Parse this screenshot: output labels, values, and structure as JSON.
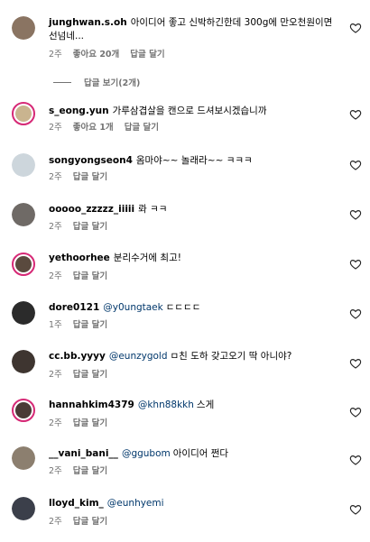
{
  "comments": [
    {
      "user": "junghwan.s.oh",
      "mention": "",
      "text": "아이디어 좋고 신박하긴한데 300g에 만오천원이면 선넘네...",
      "time": "2주",
      "likes": "좋아요 20개",
      "reply": "답글 달기",
      "avatar_color": "#8a7462",
      "ring": false
    },
    {
      "user": "s_eong.yun",
      "mention": "",
      "text": "가루삼겹살을 캔으로 드셔보시겠습니까",
      "time": "2주",
      "likes": "좋아요 1개",
      "reply": "답글 달기",
      "avatar_color": "#c9b48f",
      "ring": true
    },
    {
      "user": "songyongseon4",
      "mention": "",
      "text": "옴마야~~ 놀래라~~ ㅋㅋㅋ",
      "time": "2주",
      "likes": "",
      "reply": "답글 달기",
      "avatar_color": "#cdd6dc",
      "ring": false
    },
    {
      "user": "ooooo_zzzzz_iiiii",
      "mention": "",
      "text": "롸 ㅋㅋ",
      "time": "2주",
      "likes": "",
      "reply": "답글 달기",
      "avatar_color": "#6f6a66",
      "ring": false
    },
    {
      "user": "yethoorhee",
      "mention": "",
      "text": "분리수거에 최고!",
      "time": "2주",
      "likes": "",
      "reply": "답글 달기",
      "avatar_color": "#5a4a3e",
      "ring": true
    },
    {
      "user": "dore0121",
      "mention": "@y0ungtaek",
      "text": "ㄷㄷㄷㄷ",
      "time": "1주",
      "likes": "",
      "reply": "답글 달기",
      "avatar_color": "#2b2b2b",
      "ring": false
    },
    {
      "user": "cc.bb.yyyy",
      "mention": "@eunzygold",
      "text": "ㅁ친 도하 갖고오기 딱 아니야?",
      "time": "2주",
      "likes": "",
      "reply": "답글 달기",
      "avatar_color": "#3e3530",
      "ring": false
    },
    {
      "user": "hannahkim4379",
      "mention": "@khn88kkh",
      "text": "스게",
      "time": "2주",
      "likes": "",
      "reply": "답글 달기",
      "avatar_color": "#4a3a36",
      "ring": true
    },
    {
      "user": "__vani_bani__",
      "mention": "@ggubom",
      "text": "아이디어 쩐다",
      "time": "2주",
      "likes": "",
      "reply": "답글 달기",
      "avatar_color": "#8c7f6f",
      "ring": false
    },
    {
      "user": "lloyd_kim_",
      "mention": "@eunhyemi",
      "text": "",
      "time": "2주",
      "likes": "",
      "reply": "답글 달기",
      "avatar_color": "#3b3f4a",
      "ring": false
    }
  ],
  "view_replies": "답글 보기(2개)",
  "icons": {
    "like": "heart-outline-icon",
    "replies_line": "horizontal-line"
  },
  "colors": {
    "secondary": "#737373",
    "mention": "#00376b",
    "ring": "#d62976"
  }
}
